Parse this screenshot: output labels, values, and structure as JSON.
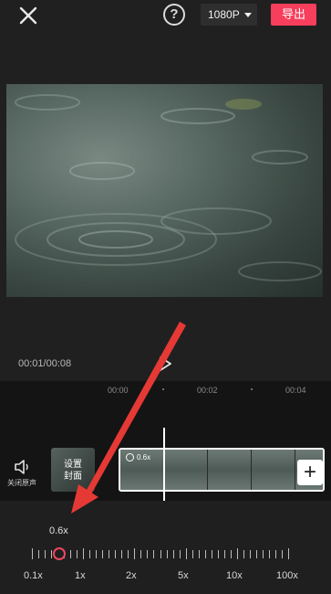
{
  "header": {
    "resolution": "1080P",
    "export_label": "导出",
    "help_label": "?"
  },
  "player": {
    "time": "00:01/00:08"
  },
  "timeline": {
    "ruler": [
      "00:00",
      "00:02",
      "00:04"
    ],
    "mute_label": "关闭原声",
    "cover_label_line1": "设置",
    "cover_label_line2": "封面",
    "clip_speed": "0.6x",
    "add_label": "+"
  },
  "speed": {
    "current": "0.6x",
    "scale": [
      "0.1x",
      "1x",
      "2x",
      "5x",
      "10x",
      "100x"
    ],
    "level": 0.6
  },
  "colors": {
    "accent": "#f73e5c",
    "background": "#202020",
    "annotation_arrow": "#e53935"
  },
  "icons": [
    "close-icon",
    "help-icon",
    "chevron-down-icon",
    "play-icon",
    "speaker-icon",
    "speed-icon",
    "plus-icon"
  ]
}
